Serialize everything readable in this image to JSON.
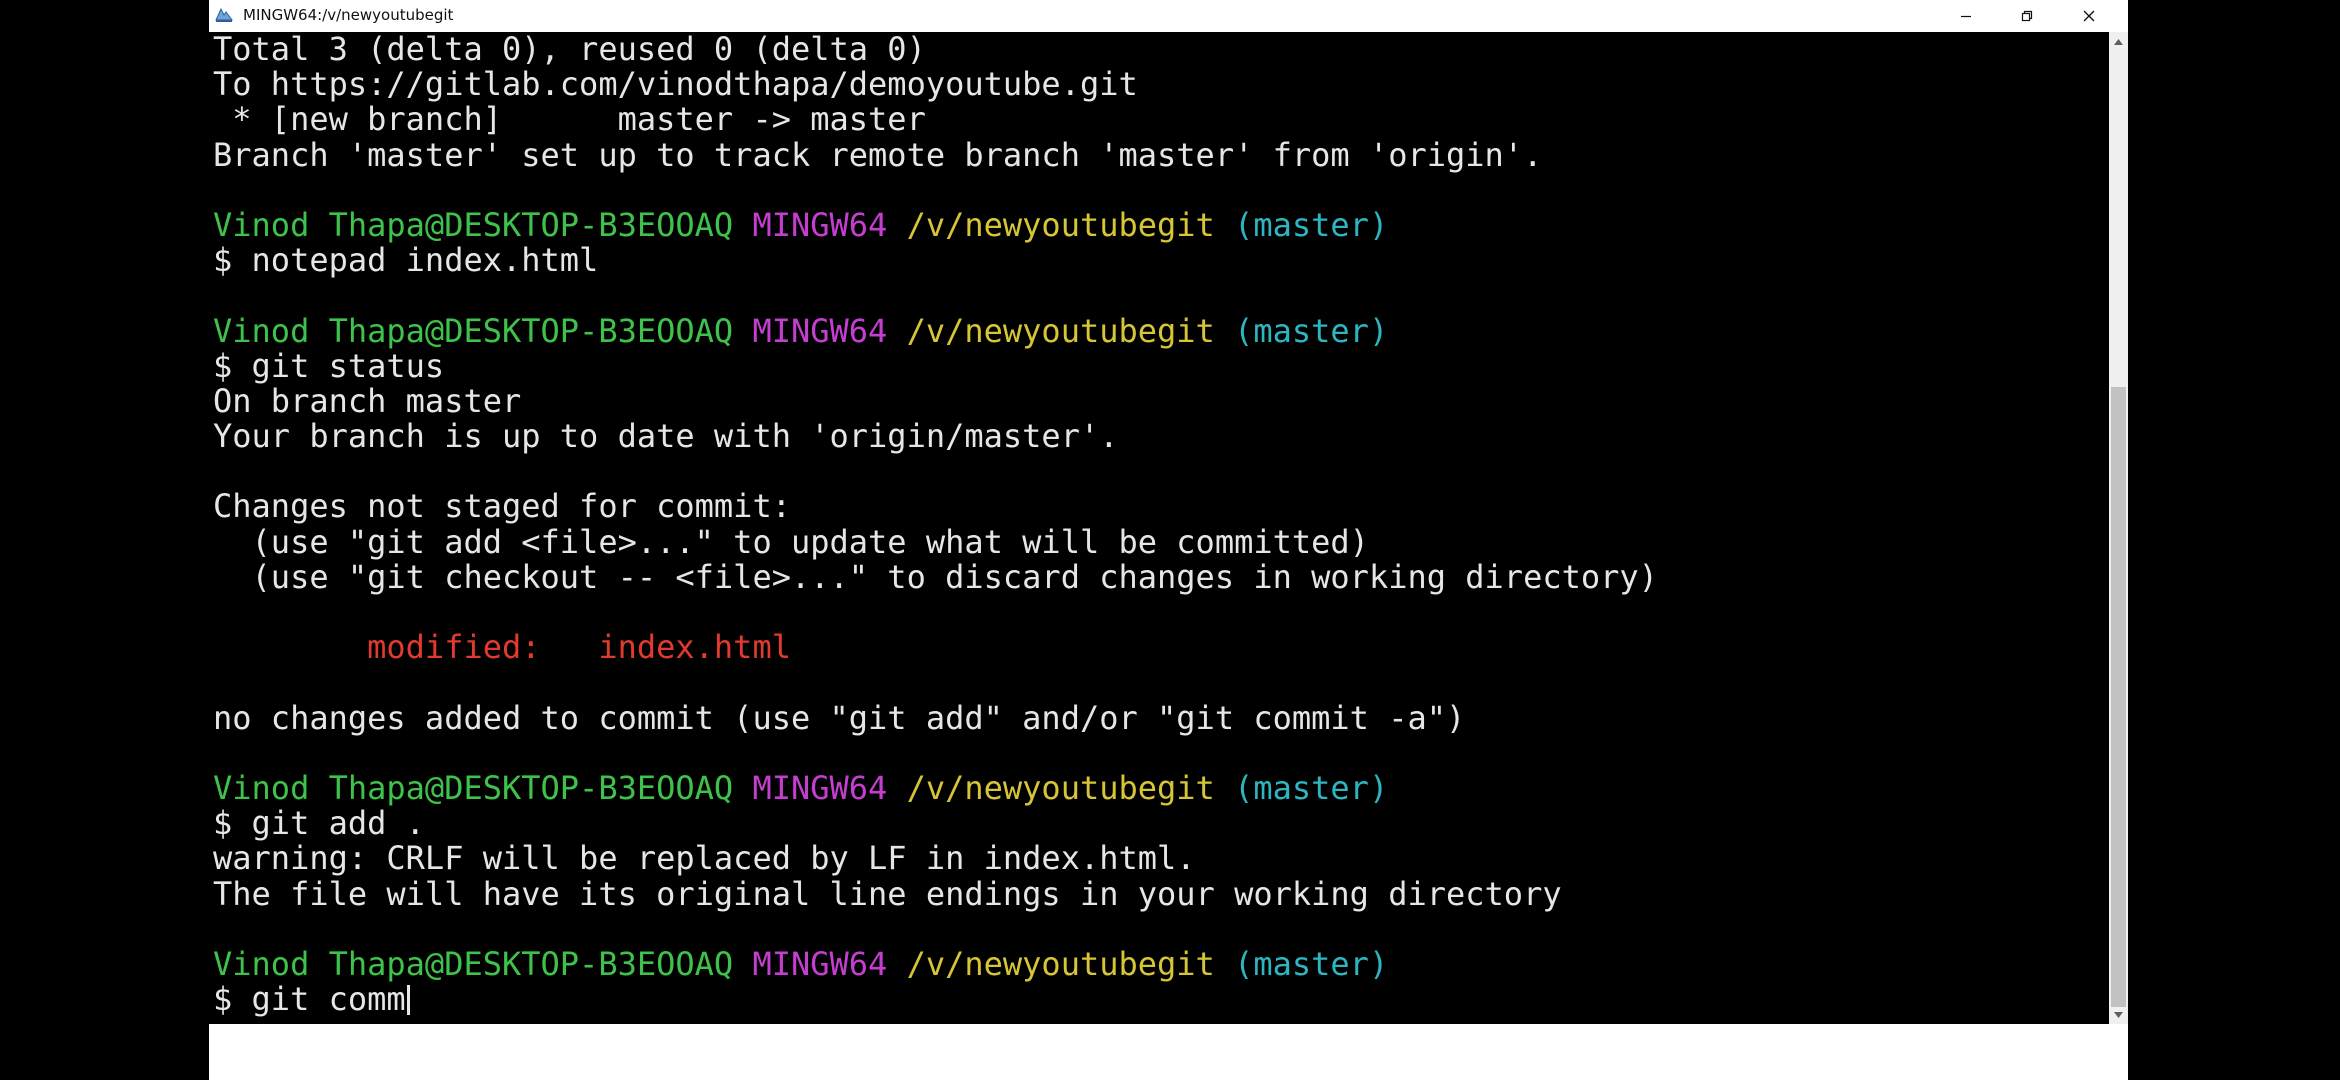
{
  "window": {
    "title": "MINGW64:/v/newyoutubegit"
  },
  "terminal": {
    "lines": [
      [
        {
          "t": "Total 3 (delta 0), reused 0 (delta 0)",
          "c": ""
        }
      ],
      [
        {
          "t": "To https://gitlab.com/vinodthapa/demoyoutube.git",
          "c": ""
        }
      ],
      [
        {
          "t": " * [new branch]      master -> master",
          "c": ""
        }
      ],
      [
        {
          "t": "Branch 'master' set up to track remote branch 'master' from 'origin'.",
          "c": ""
        }
      ],
      [],
      [
        {
          "t": "Vinod Thapa@DESKTOP-B3EOOAQ",
          "c": "green"
        },
        {
          "t": " ",
          "c": ""
        },
        {
          "t": "MINGW64",
          "c": "magenta"
        },
        {
          "t": " ",
          "c": ""
        },
        {
          "t": "/v/newyoutubegit",
          "c": "yellow"
        },
        {
          "t": " ",
          "c": ""
        },
        {
          "t": "(master)",
          "c": "cyan"
        }
      ],
      [
        {
          "t": "$ notepad index.html",
          "c": ""
        }
      ],
      [],
      [
        {
          "t": "Vinod Thapa@DESKTOP-B3EOOAQ",
          "c": "green"
        },
        {
          "t": " ",
          "c": ""
        },
        {
          "t": "MINGW64",
          "c": "magenta"
        },
        {
          "t": " ",
          "c": ""
        },
        {
          "t": "/v/newyoutubegit",
          "c": "yellow"
        },
        {
          "t": " ",
          "c": ""
        },
        {
          "t": "(master)",
          "c": "cyan"
        }
      ],
      [
        {
          "t": "$ git status",
          "c": ""
        }
      ],
      [
        {
          "t": "On branch master",
          "c": ""
        }
      ],
      [
        {
          "t": "Your branch is up to date with 'origin/master'.",
          "c": ""
        }
      ],
      [],
      [
        {
          "t": "Changes not staged for commit:",
          "c": ""
        }
      ],
      [
        {
          "t": "  (use \"git add <file>...\" to update what will be committed)",
          "c": ""
        }
      ],
      [
        {
          "t": "  (use \"git checkout -- <file>...\" to discard changes in working directory)",
          "c": ""
        }
      ],
      [],
      [
        {
          "t": "        ",
          "c": ""
        },
        {
          "t": "modified:   index.html",
          "c": "red"
        }
      ],
      [],
      [
        {
          "t": "no changes added to commit (use \"git add\" and/or \"git commit -a\")",
          "c": ""
        }
      ],
      [],
      [
        {
          "t": "Vinod Thapa@DESKTOP-B3EOOAQ",
          "c": "green"
        },
        {
          "t": " ",
          "c": ""
        },
        {
          "t": "MINGW64",
          "c": "magenta"
        },
        {
          "t": " ",
          "c": ""
        },
        {
          "t": "/v/newyoutubegit",
          "c": "yellow"
        },
        {
          "t": " ",
          "c": ""
        },
        {
          "t": "(master)",
          "c": "cyan"
        }
      ],
      [
        {
          "t": "$ git add .",
          "c": ""
        }
      ],
      [
        {
          "t": "warning: CRLF will be replaced by LF in index.html.",
          "c": ""
        }
      ],
      [
        {
          "t": "The file will have its original line endings in your working directory",
          "c": ""
        }
      ],
      [],
      [
        {
          "t": "Vinod Thapa@DESKTOP-B3EOOAQ",
          "c": "green"
        },
        {
          "t": " ",
          "c": ""
        },
        {
          "t": "MINGW64",
          "c": "magenta"
        },
        {
          "t": " ",
          "c": ""
        },
        {
          "t": "/v/newyoutubegit",
          "c": "yellow"
        },
        {
          "t": " ",
          "c": ""
        },
        {
          "t": "(master)",
          "c": "cyan"
        }
      ],
      [
        {
          "t": "$ git comm",
          "c": ""
        }
      ]
    ],
    "input_value": "$ git comm"
  },
  "colors": {
    "background": "#000000",
    "foreground": "#e6e6e6",
    "user_host": "#3ec24b",
    "system": "#c43fd0",
    "path": "#d6c535",
    "branch": "#2db6c1",
    "modified": "#e23a2e"
  },
  "icons": {
    "app": "mingw64-icon",
    "minimize": "minimize-icon",
    "maximize": "restore-icon",
    "close": "close-icon"
  }
}
